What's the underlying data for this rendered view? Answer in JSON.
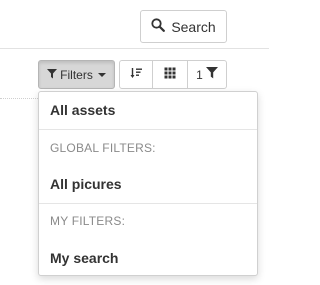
{
  "search": {
    "label": "Search",
    "icon": "search-icon"
  },
  "toolbar": {
    "filters_label": "Filters",
    "count_label": "1"
  },
  "dropdown": {
    "all_assets": "All assets",
    "global_header": "GLOBAL FILTERS:",
    "global_items": [
      "All picures"
    ],
    "my_header": "MY FILTERS:",
    "my_items": [
      "My search"
    ]
  }
}
